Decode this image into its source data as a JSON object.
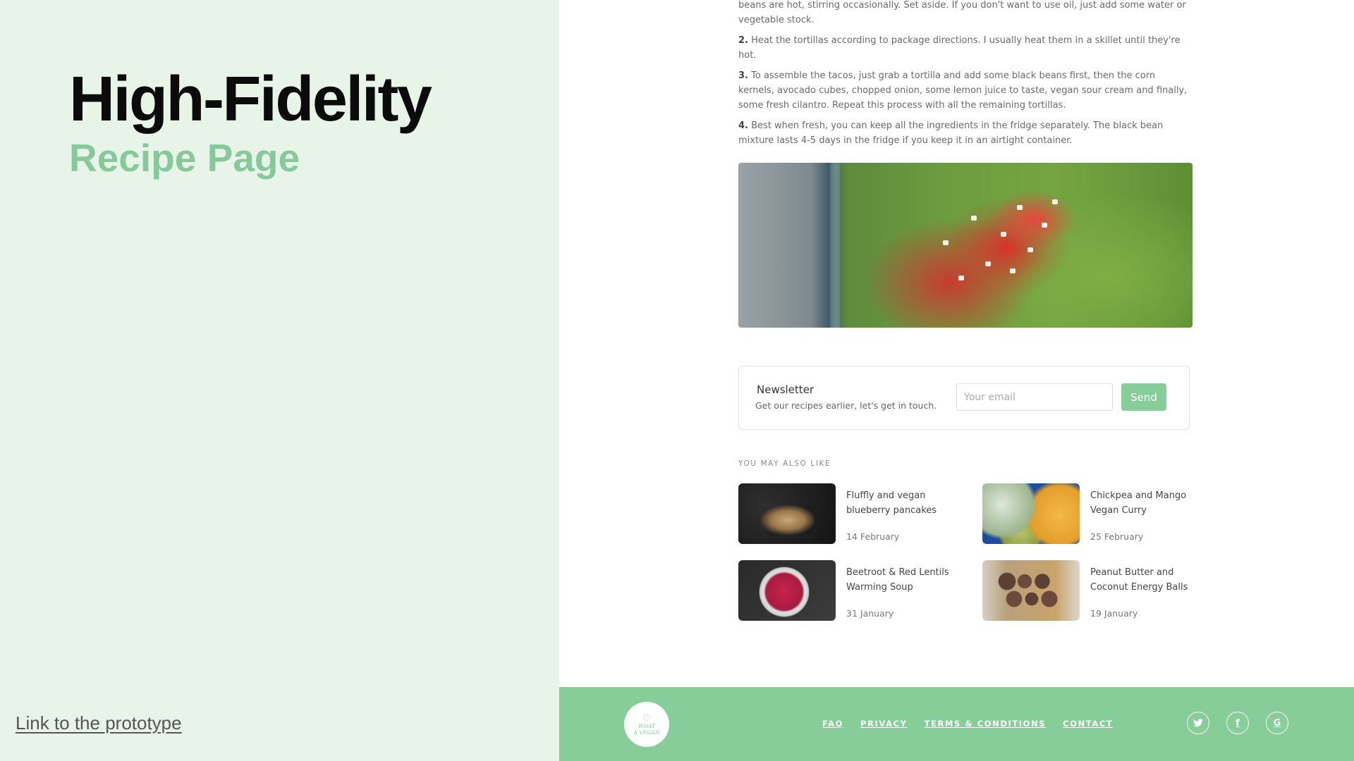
{
  "left": {
    "title": "High-Fidelity",
    "subtitle": "Recipe Page",
    "prototype_link": "Link to the prototype"
  },
  "instructions": {
    "partial": "beans are hot, stirring occasionally. Set aside. If you don't want to use oil, just add some water or vegetable stock.",
    "steps": [
      {
        "number": "2.",
        "text": "Heat the tortillas according to package directions. I usually heat them in a skillet until they're hot."
      },
      {
        "number": "3.",
        "text": "To assemble the tacos, just grab a tortilla and add some black beans first, then the corn kernels, avocado cubes, chopped onion, some lemon juice to taste, vegan sour cream and finally, some fresh cilantro. Repeat this process with all the remaining tortillas."
      },
      {
        "number": "4.",
        "text": "Best when fresh, you can keep all the ingredients in the fridge separately. The black bean mixture lasts 4-5 days in the fridge if you keep it in an airtight container."
      }
    ]
  },
  "newsletter": {
    "title": "Newsletter",
    "subtitle": "Get our recipes earlier, let's get in touch.",
    "email_value": "",
    "email_placeholder": "Your email",
    "send_label": "Send"
  },
  "related": {
    "heading": "YOU MAY ALSO LIKE",
    "items": [
      {
        "title": "Fluffly and vegan blueberry pancakes",
        "date": "14 February"
      },
      {
        "title": "Chickpea and Mango Vegan Curry",
        "date": "25 February"
      },
      {
        "title": "Beetroot & Red Lentils Warming Soup",
        "date": "31 January"
      },
      {
        "title": "Peanut Butter and Coconut Energy Balls",
        "date": "19 January"
      }
    ]
  },
  "footer": {
    "logo_text_line1": "WHAT",
    "logo_text_line2": "A VEGAN",
    "nav": [
      "FAQ",
      "PRIVACY",
      "TERMS & CONDITIONS",
      "CONTACT"
    ],
    "social": [
      {
        "icon": "twitter-icon",
        "glyph": "🐦"
      },
      {
        "icon": "facebook-icon",
        "glyph": "f"
      },
      {
        "icon": "google-icon",
        "glyph": "G"
      }
    ]
  },
  "colors": {
    "accent_green": "#86cd99",
    "left_panel_bg": "#e9f4e8",
    "title_dark": "#0b0b0b"
  }
}
